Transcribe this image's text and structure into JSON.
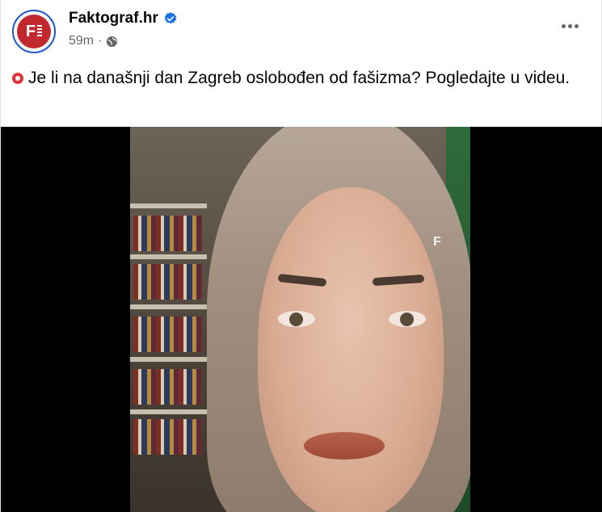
{
  "post": {
    "page_name": "Faktograf.hr",
    "avatar_letter": "F",
    "timestamp": "59m",
    "separator": "·",
    "caption": "Je li na današnji dan Zagreb oslobođen od fašizma? Pogledajte u videu.",
    "video_watermark": "F"
  },
  "colors": {
    "brand": "#c2292f",
    "verified": "#1b74e4",
    "caption_icon": "#e0333a"
  },
  "icons": [
    "verified-badge-icon",
    "globe-icon",
    "more-options-icon",
    "red-circle-icon"
  ]
}
